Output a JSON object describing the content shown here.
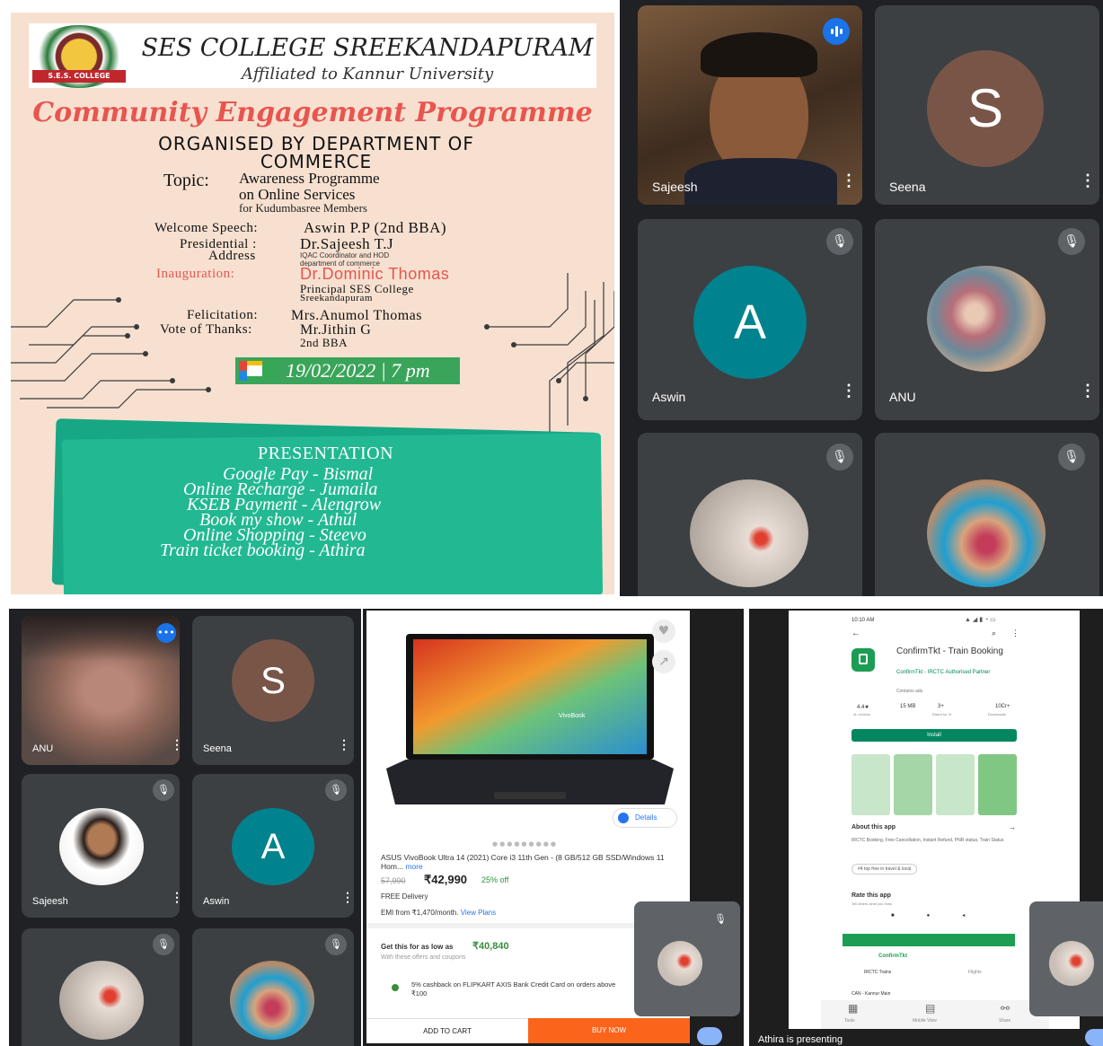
{
  "poster": {
    "college": "SES COLLEGE SREEKANDAPURAM",
    "affiliation": "Affiliated to Kannur University",
    "logo_text": "S.E.S. COLLEGE",
    "programme": "Community Engagement Programme",
    "organised_by": "ORGANISED BY DEPARTMENT OF COMMERCE",
    "topic_label": "Topic:",
    "topic_line1": "Awareness Programme",
    "topic_line2": "on Online Services",
    "topic_line3": "for Kudumbasree Members",
    "welcome_label": "Welcome Speech:",
    "welcome_value": "Aswin P.P (2nd BBA)",
    "presidential_label": "Presidential :",
    "presidential_label2": "Address",
    "presidential_value": "Dr.Sajeesh T.J",
    "presidential_sub1": "IQAC Coordinator and HOD",
    "presidential_sub2": "department of commerce",
    "inaug_label": "Inauguration:",
    "inaug_value": "Dr.Dominic Thomas",
    "inaug_sub1": "Principal SES College",
    "inaug_sub2": "Sreekandapuram",
    "felic_label": "Felicitation:",
    "felic_value": "Mrs.Anumol Thomas",
    "vote_label": "Vote of Thanks:",
    "vote_value": "Mr.Jithin G",
    "vote_sub": "2nd BBA",
    "date": "19/02/2022 | 7 pm",
    "presentation_title": "PRESENTATION",
    "presentations": [
      "Google Pay - Bismal",
      "Online Recharge - Jumaila",
      "KSEB Payment - Alengrow",
      "Book my show - Athul",
      "Online Shopping - Steevo",
      "Train ticket booking - Athira"
    ]
  },
  "meet1": {
    "tiles": [
      {
        "name": "Sajeesh"
      },
      {
        "name": "Seena",
        "initial": "S"
      },
      {
        "name": "Aswin",
        "initial": "A"
      },
      {
        "name": "ANU"
      }
    ]
  },
  "meet2": {
    "tiles": [
      {
        "name": "ANU"
      },
      {
        "name": "Seena",
        "initial": "S"
      },
      {
        "name": "Sajeesh"
      },
      {
        "name": "Aswin",
        "initial": "A"
      }
    ]
  },
  "shop": {
    "brand_overlay": "VivoBook",
    "details": "Details",
    "product": "ASUS VivoBook Ultra 14 (2021) Core i3 11th Gen - (8 GB/512 GB SSD/Windows 11 Hom...",
    "more": "more",
    "mrp": "57,990",
    "price": "₹42,990",
    "discount": "25% off",
    "delivery": "FREE Delivery",
    "emi": "EMI from ₹1,470/month.",
    "emi_link": "View Plans",
    "low_price_label": "Get this for as low as",
    "low_price": "₹40,840",
    "low_price_sub": "With these offers and coupons",
    "cashback": "5% cashback on FLIPKART AXIS Bank Credit Card on orders above ₹100",
    "add_to_cart": "ADD TO CART",
    "buy_now": "BUY NOW",
    "bottom_caption": "Athira is presenting"
  },
  "store": {
    "time": "10:10 AM",
    "app_name": "ConfirmTkt - Train Booking",
    "developer": "ConfirmTkt - IRCTC Authorised Partner",
    "contains_ads": "Contains ads",
    "stats": [
      "4.4★",
      "15 MB",
      "3+",
      "10Cr+"
    ],
    "stats_sub": [
      "4L reviews",
      "",
      "Rated for 3+",
      "Downloads"
    ],
    "install": "Install",
    "about_title": "About this app",
    "about_text": "IRCTC Booking, Free Cancellation, Instant Refund, PNR status, Train Status",
    "tag": "#4 top free in travel & local",
    "rate_title": "Rate this app",
    "rate_sub": "Tell others what you think",
    "banner_brand": "ConfirmTkt",
    "irctc": "IRCTC Trains",
    "flights": "Flights",
    "route": "CAN - Kannur Main",
    "tools": "Tools",
    "mobile_view": "Mobile View",
    "share": "Share",
    "presenting": "Athira is presenting"
  },
  "colors": {
    "meet_bg": "#202124",
    "tile_bg": "#3c4043",
    "seena_avatar": "#795548",
    "aswin_avatar": "#00838f",
    "flipkart_orange": "#fb641b",
    "install_green": "#01875f"
  }
}
